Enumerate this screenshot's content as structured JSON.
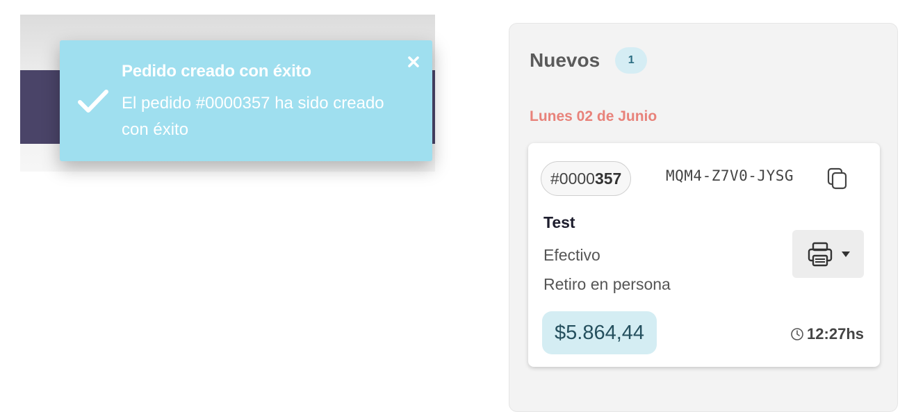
{
  "toast": {
    "title": "Pedido creado con éxito",
    "message": "El pedido #0000357 ha sido creado con éxito",
    "background_color": "#9fdfef",
    "icons": {
      "status": "check-icon",
      "close": "close-icon"
    }
  },
  "column": {
    "title": "Nuevos",
    "count": "1",
    "date_label": "Lunes 02 de Junio"
  },
  "order": {
    "id_prefix": "#0000",
    "id_suffix": "357",
    "code": "MQM4-Z7V0-JYSG",
    "customer": "Test",
    "payment": "Efectivo",
    "delivery": "Retiro en persona",
    "total": "$5.864,44",
    "time": "12:27hs",
    "icons": {
      "copy": "copy-icon",
      "print": "printer-icon",
      "dropdown": "caret-down-icon",
      "time": "clock-icon"
    }
  },
  "colors": {
    "accent_date": "#e8827a",
    "badge_bg": "#d5edf4",
    "price_bg": "#d4edf3",
    "overlay_dark": "#4a4468"
  }
}
